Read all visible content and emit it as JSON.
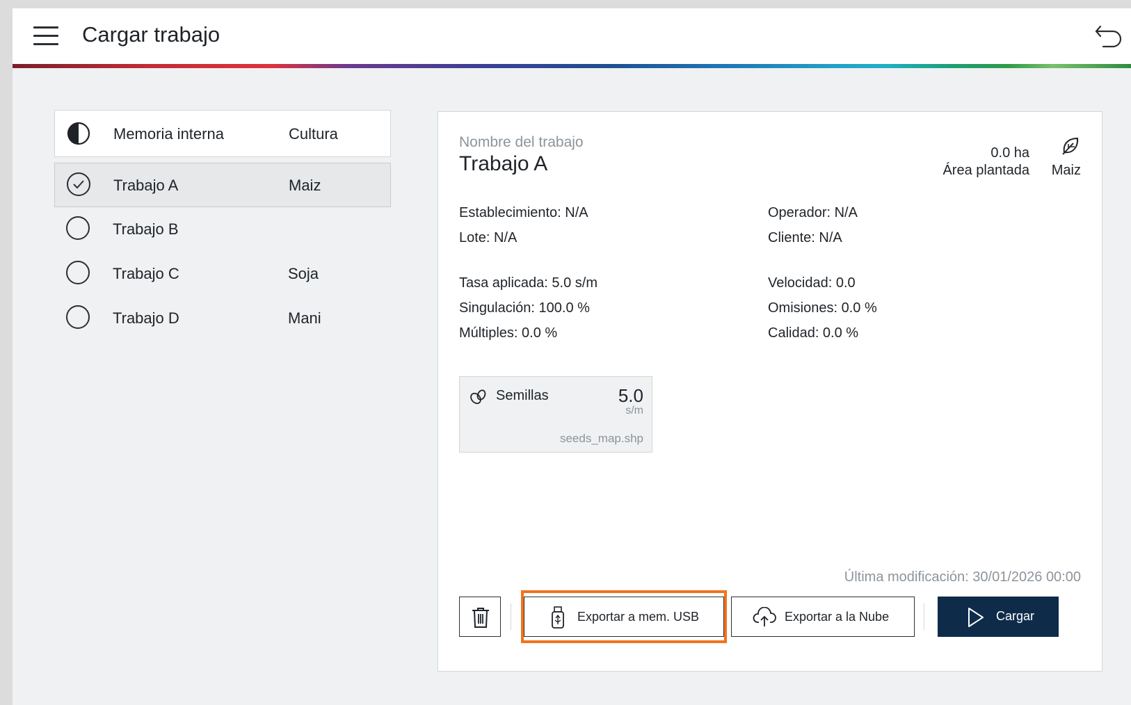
{
  "header": {
    "title": "Cargar trabajo",
    "menu_icon": "hamburger-menu-icon",
    "back_icon": "undo-arrow-icon"
  },
  "job_list": {
    "storage_label": "Memoria interna",
    "crop_column_label": "Cultura",
    "items": [
      {
        "name": "Trabajo A",
        "crop": "Maiz",
        "selected": true
      },
      {
        "name": "Trabajo B",
        "crop": "",
        "selected": false
      },
      {
        "name": "Trabajo C",
        "crop": "Soja",
        "selected": false
      },
      {
        "name": "Trabajo D",
        "crop": "Mani",
        "selected": false
      }
    ]
  },
  "detail": {
    "name_label": "Nombre del trabajo",
    "name": "Trabajo A",
    "area_value": "0.0 ha",
    "area_label": "Área plantada",
    "crop": "Maiz",
    "establecimiento": "Establecimiento: N/A",
    "lote": "Lote: N/A",
    "operador": "Operador: N/A",
    "cliente": "Cliente: N/A",
    "tasa": "Tasa aplicada: 5.0 s/m",
    "singulacion": "Singulación: 100.0 %",
    "multiples": "Múltiples: 0.0 %",
    "velocidad": "Velocidad: 0.0",
    "omisiones": "Omisiones: 0.0 %",
    "calidad": "Calidad: 0.0 %",
    "seed_card": {
      "name": "Semillas",
      "value": "5.0",
      "unit": "s/m",
      "file": "seeds_map.shp"
    },
    "last_modified": "Última modificación: 30/01/2026 00:00"
  },
  "actions": {
    "export_usb": "Exportar a mem. USB",
    "export_cloud": "Exportar a la Nube",
    "load": "Cargar",
    "highlight_color": "#f2731c",
    "load_color": "#0e2c4a"
  }
}
